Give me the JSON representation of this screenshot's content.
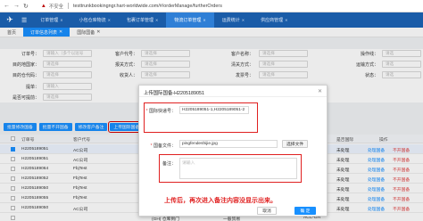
{
  "browser": {
    "back": "←",
    "forward": "→",
    "reload": "↻",
    "warning": "▲",
    "insecure": "不安全",
    "url": "testtrunkbookingngr.hart-worldwide.com/#/orderManage/furtherOrders"
  },
  "topnav": {
    "items": [
      {
        "label": "订单管理"
      },
      {
        "label": "小包仓库物流"
      },
      {
        "label": "包裹订单管理"
      },
      {
        "label": "物流订单管理",
        "active": true
      },
      {
        "label": "运费统计"
      },
      {
        "label": "供应商管理"
      }
    ]
  },
  "tabs": [
    {
      "label": "首页"
    },
    {
      "label": "订单信息列表",
      "active": true
    },
    {
      "label": "国际国备"
    }
  ],
  "form": {
    "rows": [
      [
        {
          "label": "订单号：",
          "placeholder": "请输入（多个以逗号"
        },
        {
          "label": "客户代号：",
          "placeholder": "请选择"
        },
        {
          "label": "客户名称：",
          "placeholder": "请选择"
        },
        {
          "label": "操作线：",
          "placeholder": "请选"
        }
      ],
      [
        {
          "label": "目的地国家：",
          "placeholder": "请选择"
        },
        {
          "label": "报关方式：",
          "placeholder": "请选择"
        },
        {
          "label": "清关方式：",
          "placeholder": "请选择"
        },
        {
          "label": "运输方式：",
          "placeholder": "请选"
        }
      ],
      [
        {
          "label": "目的仓代码：",
          "placeholder": "请选择"
        },
        {
          "label": "收货人：",
          "placeholder": "请选择"
        },
        {
          "label": "发票号：",
          "placeholder": "请选择"
        },
        {
          "label": "状态：",
          "placeholder": "请选"
        }
      ],
      [
        {
          "label": "提单：",
          "placeholder": "请输入"
        },
        {
          "label": "",
          "placeholder": ""
        },
        {
          "label": "",
          "placeholder": ""
        },
        {
          "label": "",
          "placeholder": ""
        }
      ],
      [
        {
          "label": "是否可提前：",
          "placeholder": "请选择"
        },
        {
          "label": "",
          "placeholder": ""
        },
        {
          "label": "",
          "placeholder": ""
        },
        {
          "label": "",
          "placeholder": ""
        }
      ]
    ]
  },
  "actions": [
    {
      "label": "批量修改国备"
    },
    {
      "label": "批量不开国备"
    },
    {
      "label": "修改客户备注"
    },
    {
      "label": "上传国际国备",
      "highlighted": true
    }
  ],
  "table": {
    "headers": [
      "订单号",
      "客户代号",
      "是否国际",
      "操作"
    ],
    "rows": [
      {
        "order": "H2205189051",
        "customer": "AC公司",
        "selected": true,
        "intl": "未处理",
        "ops": [
          "处理国备",
          "不开国备"
        ]
      },
      {
        "order": "H2205189051",
        "customer": "AC公司",
        "selected": false,
        "intl": "未处理",
        "ops": [
          "处理国备",
          "不开国备"
        ]
      },
      {
        "order": "H2205189064",
        "customer": "FbjTest",
        "selected": false,
        "intl": "未处理",
        "ops": [
          "处理国备",
          "不开国备"
        ]
      },
      {
        "order": "H2205189052",
        "customer": "FbjTest",
        "selected": false,
        "intl": "未处理",
        "ops": [
          "处理国备",
          "不开国备"
        ]
      },
      {
        "order": "H2205189050",
        "customer": "FbjTest",
        "selected": false,
        "intl": "未处理",
        "ops": [
          "处理国备",
          "不开国备"
        ]
      },
      {
        "order": "H2205189055",
        "customer": "FbjTest",
        "selected": false,
        "intl": "未处理",
        "ops": [
          "处理国备",
          "不开国备"
        ]
      },
      {
        "order": "H2205189050",
        "customer": "AC公司",
        "selected": false,
        "intl": "未处理",
        "ops": [
          "处理国备",
          "不开国备"
        ]
      },
      {
        "order": "",
        "customer": "",
        "selected": false,
        "intl": "",
        "ops": [
          "",
          ""
        ],
        "extra": [
          "(GH) 仓库到门",
          "一般贸易",
          "ACC-GH"
        ]
      }
    ]
  },
  "modal": {
    "title": "上传国际国备-H2205189051",
    "close": "✕",
    "order_label": "国际快递号：",
    "order_value": "H2205189051-1,H2205189051-2",
    "file_label": "国备文件：",
    "file_name": "pingfendeshijie.jpg",
    "file_button": "选择文件",
    "remark_label": "备注：",
    "remark_placeholder": "请输入",
    "annotation": "上传后，再次进入备注内容没显示出来。",
    "cancel": "取消",
    "confirm": "确 定"
  },
  "colors": {
    "primary": "#1890ff",
    "nav": "#1a5ca8",
    "annotation": "#e02020"
  }
}
